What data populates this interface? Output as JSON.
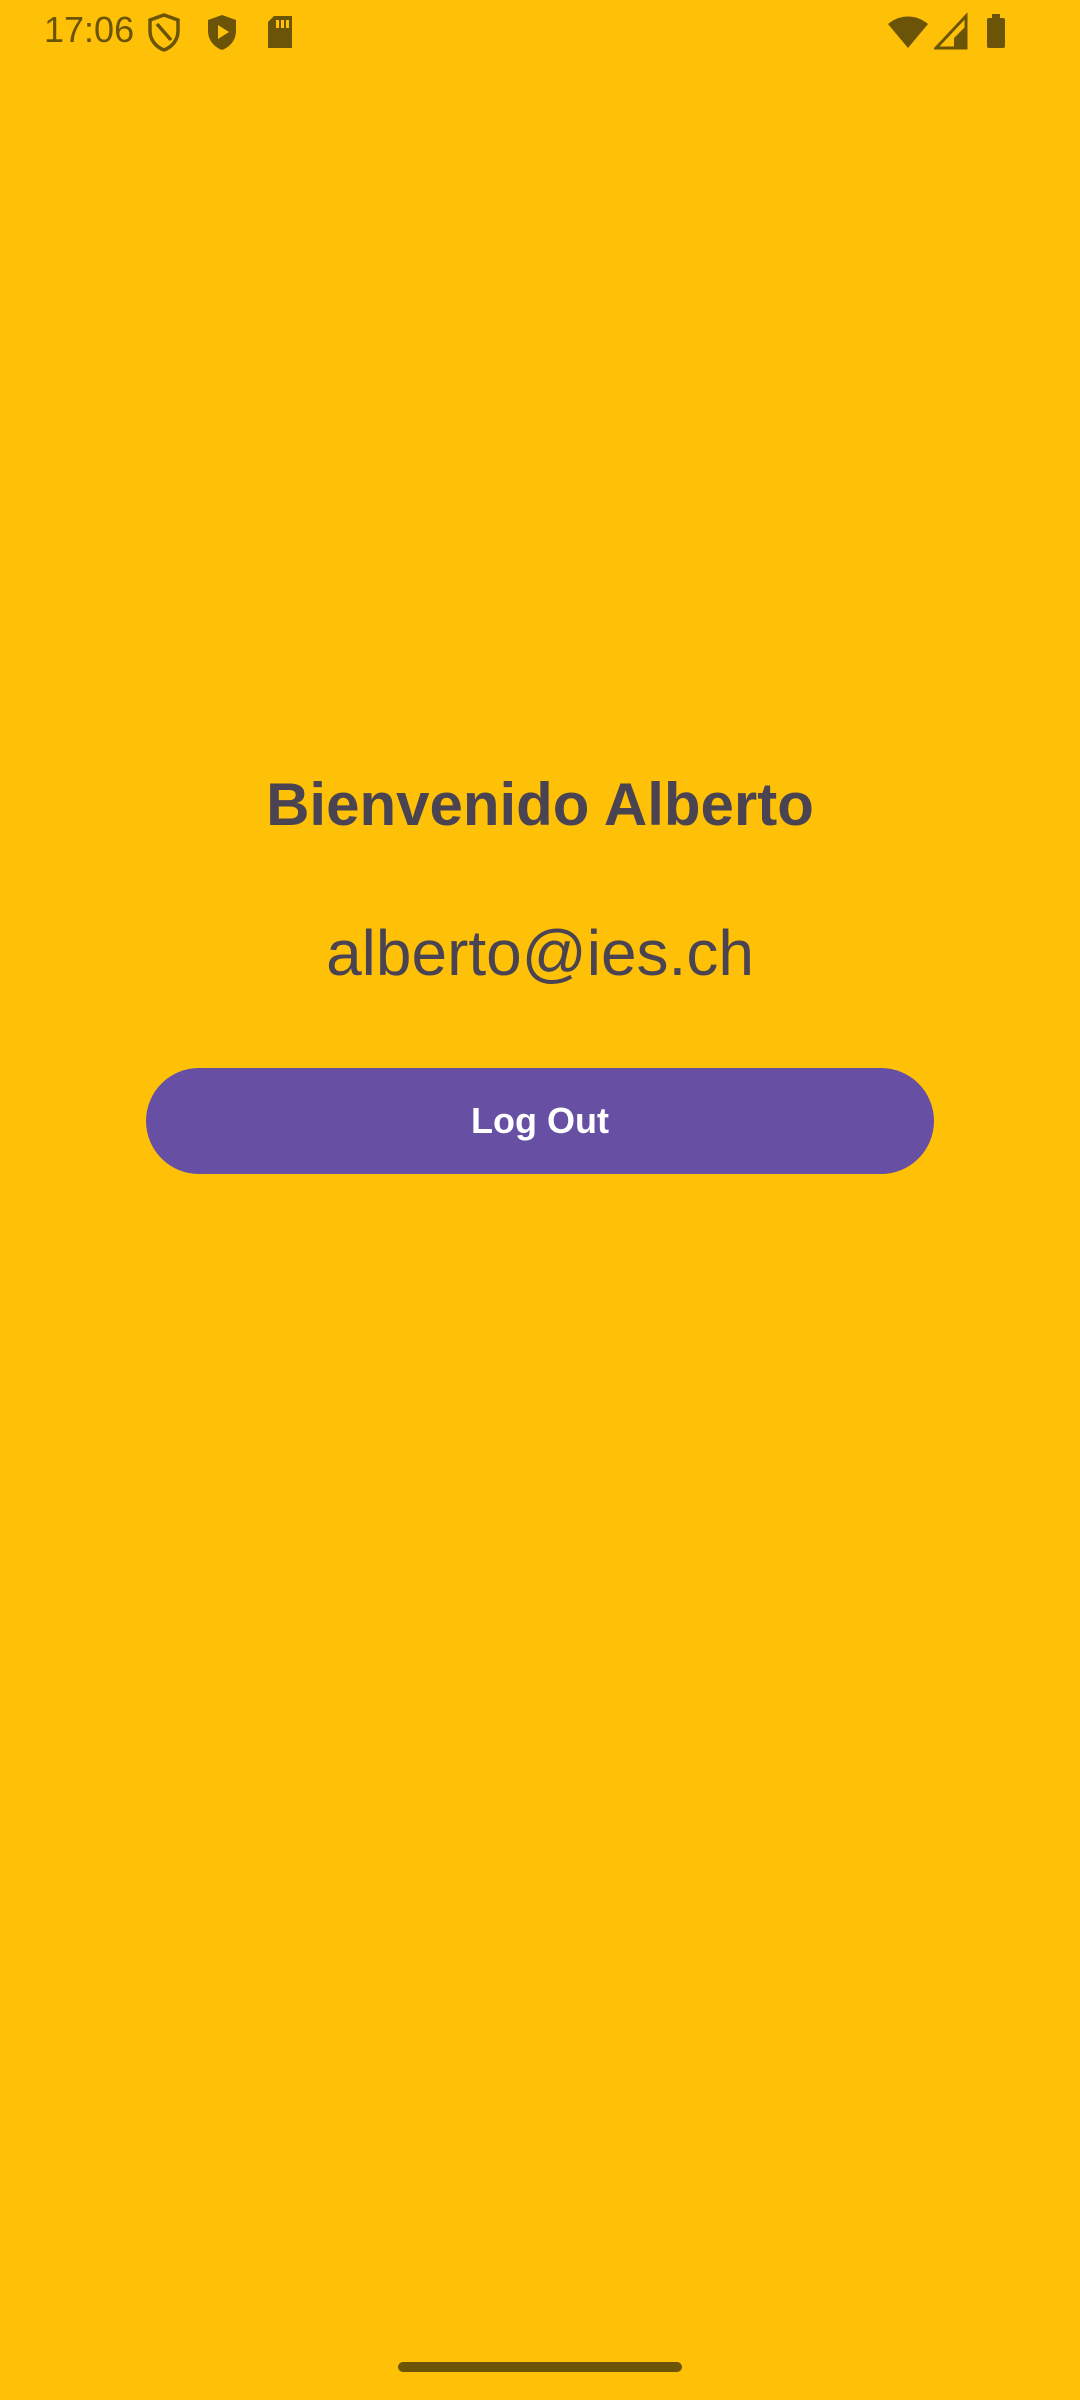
{
  "status_bar": {
    "time": "17:06",
    "left_icons": [
      "vpn-shield-icon",
      "play-protect-icon",
      "sd-card-icon"
    ],
    "right_icons": [
      "wifi-icon",
      "signal-icon",
      "battery-icon"
    ]
  },
  "main": {
    "welcome_text": "Bienvenido Alberto",
    "email_text": "alberto@ies.ch",
    "logout_label": "Log Out"
  },
  "colors": {
    "background": "#FFC107",
    "text": "#4A4452",
    "button": "#6750A4",
    "status_icons": "#6B5407"
  }
}
